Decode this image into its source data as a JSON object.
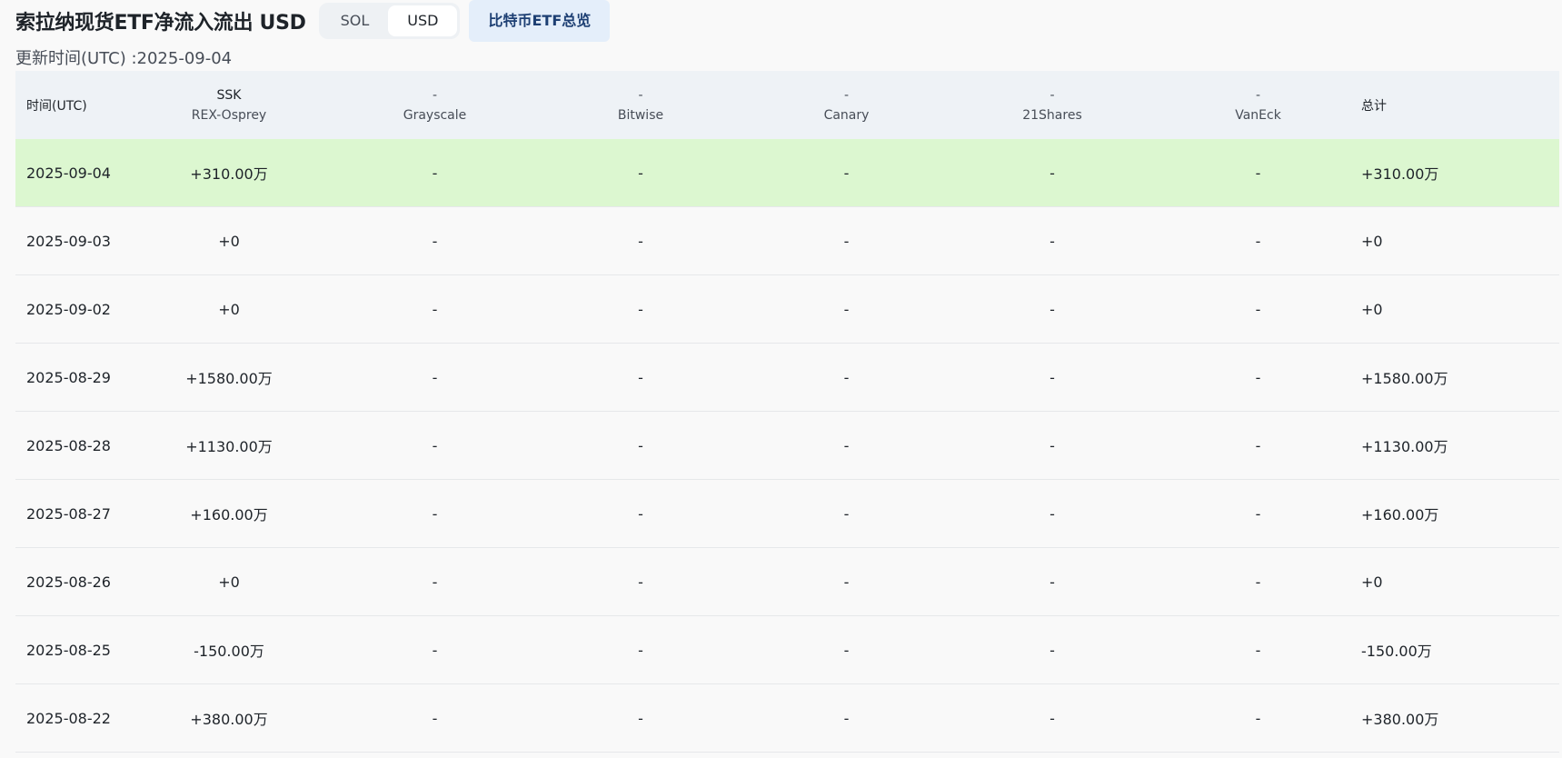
{
  "header": {
    "title": "索拉纳现货ETF净流入流出 USD",
    "unit_toggle": {
      "options": [
        "SOL",
        "USD"
      ],
      "selected": "USD"
    },
    "overview_button": "比特币ETF总览",
    "update_time": "更新时间(UTC) :2025-09-04"
  },
  "table": {
    "columns": {
      "date": "时间(UTC)",
      "ssk": {
        "ticker": "SSK",
        "issuer": "REX-Osprey"
      },
      "grayscale": {
        "ticker": "-",
        "issuer": "Grayscale"
      },
      "bitwise": {
        "ticker": "-",
        "issuer": "Bitwise"
      },
      "canary": {
        "ticker": "-",
        "issuer": "Canary"
      },
      "21shares": {
        "ticker": "-",
        "issuer": "21Shares"
      },
      "vaneck": {
        "ticker": "-",
        "issuer": "VanEck"
      },
      "total": "总计"
    },
    "rows": [
      {
        "date": "2025-09-04",
        "ssk": "+310.00万",
        "grayscale": "-",
        "bitwise": "-",
        "canary": "-",
        "shares21": "-",
        "vaneck": "-",
        "total": "+310.00万",
        "sign": "pos"
      },
      {
        "date": "2025-09-03",
        "ssk": "+0",
        "grayscale": "-",
        "bitwise": "-",
        "canary": "-",
        "shares21": "-",
        "vaneck": "-",
        "total": "+0",
        "sign": "neg"
      },
      {
        "date": "2025-09-02",
        "ssk": "+0",
        "grayscale": "-",
        "bitwise": "-",
        "canary": "-",
        "shares21": "-",
        "vaneck": "-",
        "total": "+0",
        "sign": "neg"
      },
      {
        "date": "2025-08-29",
        "ssk": "+1580.00万",
        "grayscale": "-",
        "bitwise": "-",
        "canary": "-",
        "shares21": "-",
        "vaneck": "-",
        "total": "+1580.00万",
        "sign": "pos"
      },
      {
        "date": "2025-08-28",
        "ssk": "+1130.00万",
        "grayscale": "-",
        "bitwise": "-",
        "canary": "-",
        "shares21": "-",
        "vaneck": "-",
        "total": "+1130.00万",
        "sign": "pos"
      },
      {
        "date": "2025-08-27",
        "ssk": "+160.00万",
        "grayscale": "-",
        "bitwise": "-",
        "canary": "-",
        "shares21": "-",
        "vaneck": "-",
        "total": "+160.00万",
        "sign": "pos"
      },
      {
        "date": "2025-08-26",
        "ssk": "+0",
        "grayscale": "-",
        "bitwise": "-",
        "canary": "-",
        "shares21": "-",
        "vaneck": "-",
        "total": "+0",
        "sign": "neg"
      },
      {
        "date": "2025-08-25",
        "ssk": "-150.00万",
        "grayscale": "-",
        "bitwise": "-",
        "canary": "-",
        "shares21": "-",
        "vaneck": "-",
        "total": "-150.00万",
        "sign": "neg"
      },
      {
        "date": "2025-08-22",
        "ssk": "+380.00万",
        "grayscale": "-",
        "bitwise": "-",
        "canary": "-",
        "shares21": "-",
        "vaneck": "-",
        "total": "+380.00万",
        "sign": "pos"
      }
    ]
  },
  "colors": {
    "positive": "#1f9d77",
    "negative": "#e03b4b",
    "highlight_row": "#dcf7d0",
    "header_bg": "#eef2f6",
    "overview_button_bg": "#e4eefa"
  }
}
